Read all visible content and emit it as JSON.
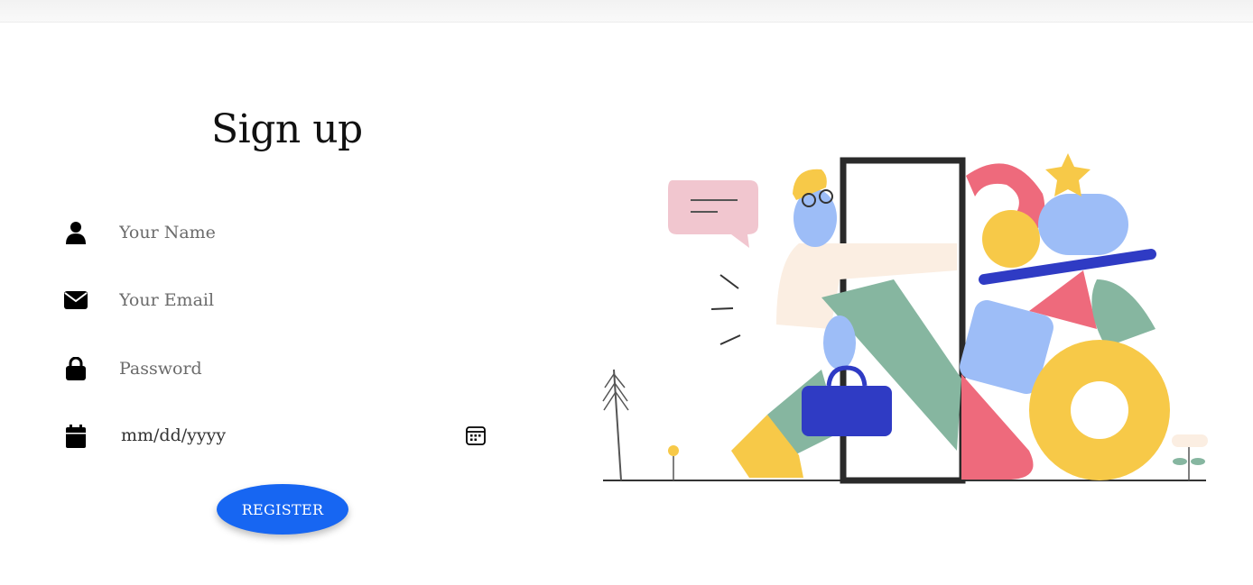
{
  "form": {
    "title": "Sign up",
    "name_placeholder": "Your Name",
    "email_placeholder": "Your Email",
    "password_placeholder": "Password",
    "date_placeholder": "mm/dd/yyyy",
    "register_label": "REGISTER"
  },
  "icons": {
    "name": "user-icon",
    "email": "envelope-icon",
    "password": "lock-icon",
    "date": "calendar-icon",
    "date_picker": "calendar-picker-icon"
  },
  "colors": {
    "primary": "#1766f2",
    "text": "#111111",
    "placeholder": "#6b6b6b"
  }
}
